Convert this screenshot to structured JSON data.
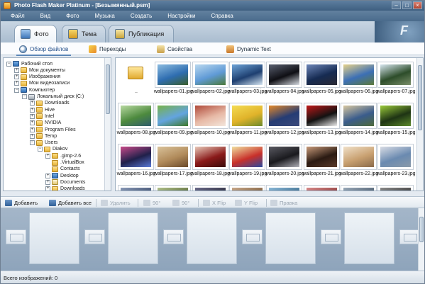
{
  "window": {
    "title": "Photo Flash Maker Platinum - [Безымянный.psm]",
    "controls": {
      "minimize": "–",
      "maximize": "□",
      "close": "×"
    }
  },
  "menu": [
    "Файл",
    "Вид",
    "Фото",
    "Музыка",
    "Создать",
    "Настройки",
    "Справка"
  ],
  "main_tabs": [
    {
      "label": "Фото",
      "icon": "photo-icon",
      "active": true
    },
    {
      "label": "Тема",
      "icon": "theme-icon",
      "active": false
    },
    {
      "label": "Публикация",
      "icon": "publish-icon",
      "active": false
    }
  ],
  "brand_text": "F",
  "sub_tabs": [
    {
      "label": "Обзор файлов",
      "icon": "browse-files-icon",
      "active": true
    },
    {
      "label": "Переходы",
      "icon": "transitions-icon",
      "active": false
    },
    {
      "label": "Свойства",
      "icon": "properties-icon",
      "active": false
    },
    {
      "label": "Dynamic Text",
      "icon": "dynamic-text-icon",
      "active": false
    }
  ],
  "tree": [
    {
      "label": "Рабочий стол",
      "level": 0,
      "expander": "−",
      "icon": "desktop-icon"
    },
    {
      "label": "Мои документы",
      "level": 1,
      "expander": "+",
      "icon": "folder-icon"
    },
    {
      "label": "Изображения",
      "level": 1,
      "expander": "+",
      "icon": "folder-icon"
    },
    {
      "label": "Мои видеозаписи",
      "level": 1,
      "expander": "+",
      "icon": "folder-icon"
    },
    {
      "label": "Компьютер",
      "level": 1,
      "expander": "−",
      "icon": "computer-icon"
    },
    {
      "label": "Локальный диск (C:)",
      "level": 2,
      "expander": "−",
      "icon": "drive-icon"
    },
    {
      "label": "Downloads",
      "level": 3,
      "expander": "+",
      "icon": "folder-icon"
    },
    {
      "label": "Hive",
      "level": 3,
      "expander": "+",
      "icon": "folder-icon"
    },
    {
      "label": "Intel",
      "level": 3,
      "expander": "+",
      "icon": "folder-icon"
    },
    {
      "label": "NVIDIA",
      "level": 3,
      "expander": "+",
      "icon": "folder-icon"
    },
    {
      "label": "Program Files",
      "level": 3,
      "expander": "+",
      "icon": "folder-icon"
    },
    {
      "label": "Temp",
      "level": 3,
      "expander": "+",
      "icon": "folder-icon"
    },
    {
      "label": "Users",
      "level": 3,
      "expander": "−",
      "icon": "folder-icon"
    },
    {
      "label": "Diakov",
      "level": 4,
      "expander": "−",
      "icon": "folder-icon"
    },
    {
      "label": ".gimp-2.6",
      "level": 5,
      "expander": "+",
      "icon": "folder-icon"
    },
    {
      "label": ".VirtualBox",
      "level": 5,
      "expander": "",
      "icon": "folder-icon"
    },
    {
      "label": "Contacts",
      "level": 5,
      "expander": "",
      "icon": "folder-icon"
    },
    {
      "label": "Desktop",
      "level": 5,
      "expander": "+",
      "icon": "desktop-icon"
    },
    {
      "label": "Documents",
      "level": 5,
      "expander": "+",
      "icon": "docs-icon"
    },
    {
      "label": "Downloads",
      "level": 5,
      "expander": "+",
      "icon": "folder-icon"
    }
  ],
  "files": [
    {
      "name": "..",
      "type": "parent-folder"
    },
    {
      "name": "wallpapers-01.jpg",
      "colors": [
        "#2e6db0",
        "#8bbbe0",
        "#3b5f2c"
      ]
    },
    {
      "name": "wallpapers-02.jpg",
      "colors": [
        "#5f9ad6",
        "#b9d8ef",
        "#4c7a3a"
      ]
    },
    {
      "name": "wallpapers-03.jpg",
      "colors": [
        "#1e3f70",
        "#6ea4d8",
        "#d6e6f2"
      ]
    },
    {
      "name": "wallpapers-04.jpg",
      "colors": [
        "#0f0f14",
        "#5a6070",
        "#d8dde4"
      ]
    },
    {
      "name": "wallpapers-05.jpg",
      "colors": [
        "#162b52",
        "#6d86b8",
        "#2a2a34"
      ]
    },
    {
      "name": "wallpapers-06.jpg",
      "colors": [
        "#3c6fb5",
        "#e7d28a",
        "#5e7a3a"
      ]
    },
    {
      "name": "wallpapers-07.jpg",
      "colors": [
        "#2d4d2a",
        "#d7e6ef",
        "#7a8f6a"
      ]
    },
    {
      "name": "wallpapers-08.jpg",
      "colors": [
        "#4d8a3e",
        "#b7d9a0",
        "#2f5d6e"
      ]
    },
    {
      "name": "wallpapers-09.jpg",
      "colors": [
        "#63a4e0",
        "#78b24a",
        "#3f7a2c"
      ]
    },
    {
      "name": "wallpapers-10.jpg",
      "colors": [
        "#e7b9a6",
        "#b04a3a",
        "#f3e6dc"
      ]
    },
    {
      "name": "wallpapers-11.jpg",
      "colors": [
        "#e0b32a",
        "#f4dc54",
        "#6b8a2c"
      ]
    },
    {
      "name": "wallpapers-12.jpg",
      "colors": [
        "#253c74",
        "#e58a2a",
        "#3a4a7c"
      ]
    },
    {
      "name": "wallpapers-13.jpg",
      "colors": [
        "#121212",
        "#c01818",
        "#eeeeee"
      ]
    },
    {
      "name": "wallpapers-14.jpg",
      "colors": [
        "#3a5c8c",
        "#d8c7a0",
        "#4f6b3a"
      ]
    },
    {
      "name": "wallpapers-15.jpg",
      "colors": [
        "#1e3414",
        "#9acb3a",
        "#5c8a2c"
      ]
    },
    {
      "name": "wallpapers-16.jpg",
      "colors": [
        "#20204a",
        "#c84a8a",
        "#5a7ad8"
      ]
    },
    {
      "name": "wallpapers-17.jpg",
      "colors": [
        "#b08a5a",
        "#d9c29a",
        "#6a4a2a"
      ]
    },
    {
      "name": "wallpapers-18.jpg",
      "colors": [
        "#8a1a1a",
        "#e8c8b8",
        "#3a0a0a"
      ]
    },
    {
      "name": "wallpapers-19.jpg",
      "colors": [
        "#c8302a",
        "#f0e0a0",
        "#2a4aa0"
      ]
    },
    {
      "name": "wallpapers-20.jpg",
      "colors": [
        "#1a1a1e",
        "#5a5a62",
        "#b0b0b8"
      ]
    },
    {
      "name": "wallpapers-21.jpg",
      "colors": [
        "#2a1a12",
        "#c89a7a",
        "#5a3a2a"
      ]
    },
    {
      "name": "wallpapers-22.jpg",
      "colors": [
        "#c8a070",
        "#f0e0c8",
        "#8a6a4a"
      ]
    },
    {
      "name": "wallpapers-23.jpg",
      "colors": [
        "#6a8ab0",
        "#d8dce4",
        "#8a9aaa"
      ]
    },
    {
      "name": "",
      "colors": [
        "#3a4a6a",
        "#8a9ab8",
        "#2a3a4a"
      ]
    },
    {
      "name": "",
      "colors": [
        "#5a6a3a",
        "#b0c08a",
        "#3a4a2a"
      ]
    },
    {
      "name": "",
      "colors": [
        "#2a2a3a",
        "#6a6a8a",
        "#1a1a2a"
      ]
    },
    {
      "name": "",
      "colors": [
        "#7a5a3a",
        "#c8a88a",
        "#4a3a2a"
      ]
    },
    {
      "name": "",
      "colors": [
        "#3a6a8a",
        "#8ab8d8",
        "#2a4a6a"
      ]
    },
    {
      "name": "",
      "colors": [
        "#8a3a3a",
        "#d88a8a",
        "#5a2a2a"
      ]
    },
    {
      "name": "",
      "colors": [
        "#4a5a6a",
        "#9aaaba",
        "#2a3a4a"
      ]
    },
    {
      "name": "",
      "colors": [
        "#3a3a3a",
        "#8a8a8a",
        "#1a1a1a"
      ]
    }
  ],
  "toolbar": [
    {
      "label": "Добавить",
      "icon": "add-icon",
      "enabled": true
    },
    {
      "label": "Добавить все",
      "icon": "add-all-icon",
      "enabled": true
    },
    {
      "label": "Удалить",
      "icon": "delete-icon",
      "enabled": false
    },
    {
      "label": "90°",
      "icon": "rotate-left-icon",
      "enabled": false
    },
    {
      "label": "90°",
      "icon": "rotate-right-icon",
      "enabled": false
    },
    {
      "label": "X Flip",
      "icon": "flip-x-icon",
      "enabled": false
    },
    {
      "label": "Y Flip",
      "icon": "flip-y-icon",
      "enabled": false
    },
    {
      "label": "Правка",
      "icon": "edit-icon",
      "enabled": false
    }
  ],
  "status": {
    "text": "Всего изображений: 0"
  },
  "colors": {
    "titlebar": "#4e6f90",
    "accent": "#2f5f97",
    "panel_bg": "#ffffff",
    "storyboard_bg": "#98adc2"
  }
}
